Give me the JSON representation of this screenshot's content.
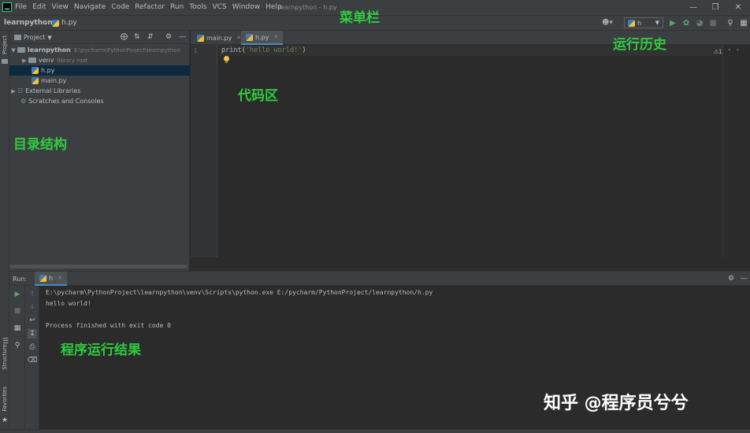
{
  "title_bar": {
    "menu": [
      "File",
      "Edit",
      "View",
      "Navigate",
      "Code",
      "Refactor",
      "Run",
      "Tools",
      "VCS",
      "Window",
      "Help"
    ],
    "window_title": "learnpython - h.py",
    "controls": {
      "minimize": "—",
      "maximize": "❐",
      "close": "✕"
    }
  },
  "nav_bar": {
    "project": "learnpython",
    "separator": "›",
    "file": "h.py",
    "run_config": "h"
  },
  "project_panel": {
    "title": "Project",
    "side_label": "Project",
    "tree": [
      {
        "label": "learnpython",
        "extra": "E:\\pycharm\\PythonProject\\learnpython"
      },
      {
        "label": "venv",
        "extra": "library root"
      },
      {
        "label": "h.py",
        "extra": ""
      },
      {
        "label": "main.py",
        "extra": ""
      },
      {
        "label": "External Libraries",
        "extra": ""
      },
      {
        "label": "Scratches and Consoles",
        "extra": ""
      }
    ]
  },
  "editor": {
    "tabs": [
      {
        "label": "main.py",
        "active": false
      },
      {
        "label": "h.py",
        "active": true
      }
    ],
    "line_number": "1",
    "code": {
      "func": "print",
      "open": "(",
      "string": "'hello world!'",
      "close": ")"
    },
    "warning_count": "⚠1"
  },
  "run_panel": {
    "label": "Run:",
    "tab": "h",
    "output": [
      "E:\\pycharm\\PythonProject\\learnpython\\venv\\Scripts\\python.exe E:/pycharm/PythonProject/learnpython/h.py",
      "hello world!",
      "",
      "Process finished with exit code 0"
    ]
  },
  "side_tools": {
    "structure": "Structure",
    "favorites": "Favorites"
  },
  "annotations": {
    "menu_bar": "菜单栏",
    "run_history": "运行历史",
    "code_area": "代码区",
    "dir_structure": "目录结构",
    "run_result": "程序运行结果"
  },
  "watermark": "知乎 @程序员兮兮",
  "colors": {
    "code_func": "#a9b7c6",
    "code_string": "#6a8759",
    "code_paren": "#e8bf6a",
    "annotation": "#2ecc40",
    "selected_row": "#0d293e",
    "run_green": "#59a869"
  }
}
